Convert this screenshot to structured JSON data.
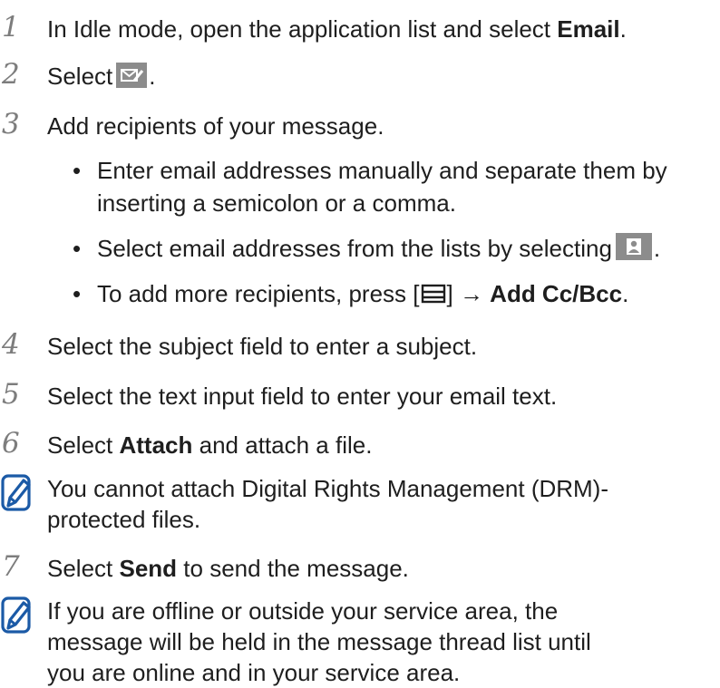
{
  "steps": [
    {
      "num": "1",
      "pre": "In Idle mode, open the application list and select ",
      "bold": "Email",
      "post": "."
    },
    {
      "num": "2",
      "pre": "Select",
      "post": ".",
      "icon": "compose-email-icon"
    },
    {
      "num": "3",
      "text": "Add recipients of your message."
    },
    {
      "num": "4",
      "text": "Select the subject field to enter a subject."
    },
    {
      "num": "5",
      "text": "Select the text input field to enter your email text."
    },
    {
      "num": "6",
      "pre": "Select ",
      "bold": "Attach",
      "post": " and attach a file."
    },
    {
      "num": "7",
      "pre": "Select ",
      "bold": "Send",
      "post": " to send the message."
    }
  ],
  "bullets": [
    {
      "line1": "Enter email addresses manually and separate them by",
      "line2": "inserting a semicolon or a comma."
    },
    {
      "pre": "Select email addresses from the lists by selecting",
      "post": ".",
      "icon": "contact-icon"
    },
    {
      "pre": "To add more recipients, press [",
      "mid": "] → ",
      "bold": "Add Cc/Bcc",
      "post": ".",
      "icon": "menu-key-icon"
    }
  ],
  "notes": [
    {
      "line1": "You cannot attach Digital Rights Management (DRM)-",
      "line2": "protected files."
    },
    {
      "line1": "If you are offline or outside your service area, the",
      "line2": "message will be held in the message thread list until",
      "line3": "you are online and in your service area."
    }
  ],
  "bullet_char": "•",
  "colors": {
    "text": "#1e1e1e",
    "step_number": "#7d7d7d",
    "note_icon": "#1b5aa6",
    "icon_bg": "#8c8c8c"
  }
}
